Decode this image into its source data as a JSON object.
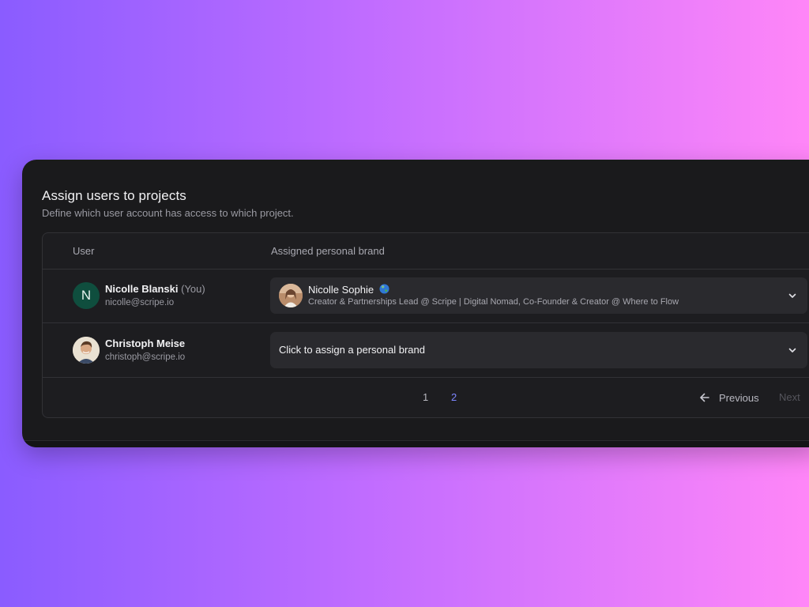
{
  "header": {
    "title": "Assign users to projects",
    "subtitle": "Define which user account has access to which project."
  },
  "table": {
    "columns": [
      "User",
      "Assigned personal brand"
    ],
    "rows": [
      {
        "initial": "N",
        "name": "Nicolle Blanski",
        "you": "(You)",
        "email": "nicolle@scripe.io",
        "brand_name": "Nicolle Sophie",
        "brand_desc": "Creator & Partnerships Lead @ Scripe | Digital Nomad, Co-Founder & Creator @ Where to Flow"
      },
      {
        "name": "Christoph Meise",
        "email": "christoph@scripe.io",
        "placeholder": "Click to assign a personal brand"
      }
    ]
  },
  "pagination": {
    "pages": [
      "1",
      "2"
    ],
    "current_page": "2",
    "previous_label": "Previous",
    "next_label": "Next"
  },
  "icons": {
    "initial_avatar": "letter-avatar",
    "photo_avatar": "user-photo",
    "brand_avatar": "brand-photo",
    "globe": "globe-icon",
    "chevron": "chevron-down-icon",
    "previous": "arrow-left-icon"
  },
  "colors": {
    "card_bg": "#1a1a1c",
    "avatar_green": "#0f4e3e",
    "active_page": "#7d86ff",
    "gradient_start": "#8a5cff",
    "gradient_end": "#ff86f8"
  }
}
